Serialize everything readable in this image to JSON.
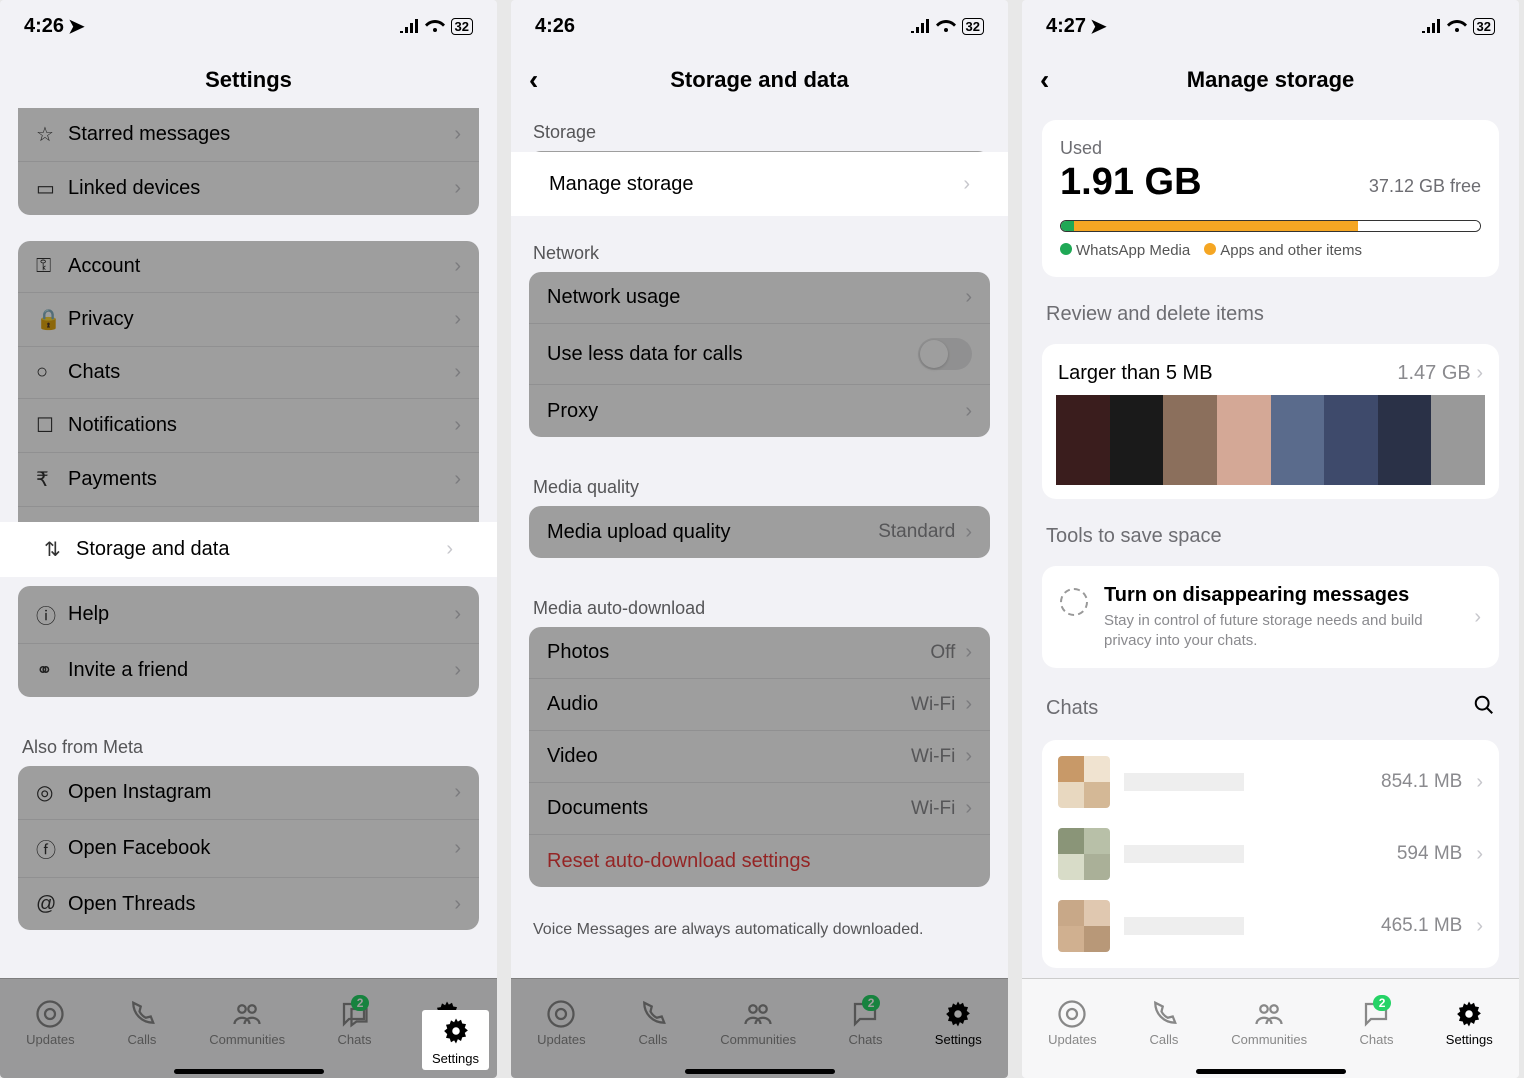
{
  "status": {
    "time1": "4:26",
    "time2": "4:26",
    "time3": "4:27",
    "battery_pct": "32"
  },
  "screen1": {
    "title": "Settings",
    "rows_top": [
      {
        "icon": "☆",
        "label": "Starred messages"
      },
      {
        "icon": "⌐",
        "label": "Linked devices"
      }
    ],
    "rows_main": [
      {
        "icon": "key",
        "label": "Account"
      },
      {
        "icon": "lock",
        "label": "Privacy"
      },
      {
        "icon": "chat",
        "label": "Chats"
      },
      {
        "icon": "bell",
        "label": "Notifications"
      },
      {
        "icon": "pay",
        "label": "Payments"
      },
      {
        "icon": "updown",
        "label": "Storage and data"
      }
    ],
    "rows_help": [
      {
        "icon": "info",
        "label": "Help"
      },
      {
        "icon": "people",
        "label": "Invite a friend"
      }
    ],
    "meta_header": "Also from Meta",
    "rows_meta": [
      {
        "icon": "ig",
        "label": "Open Instagram"
      },
      {
        "icon": "fb",
        "label": "Open Facebook"
      },
      {
        "icon": "th",
        "label": "Open Threads"
      }
    ]
  },
  "screen2": {
    "title": "Storage and data",
    "storage_header": "Storage",
    "manage_storage": "Manage storage",
    "network_header": "Network",
    "network_usage": "Network usage",
    "use_less_data": "Use less data for calls",
    "proxy": "Proxy",
    "media_quality_header": "Media quality",
    "media_upload": "Media upload quality",
    "media_upload_value": "Standard",
    "auto_download_header": "Media auto-download",
    "photos": "Photos",
    "photos_val": "Off",
    "audio": "Audio",
    "audio_val": "Wi-Fi",
    "video": "Video",
    "video_val": "Wi-Fi",
    "documents": "Documents",
    "documents_val": "Wi-Fi",
    "reset": "Reset auto-download settings",
    "voice_note": "Voice Messages are always automatically downloaded."
  },
  "screen3": {
    "title": "Manage storage",
    "used_label": "Used",
    "used_value": "1.91 GB",
    "free_label": "37.12 GB free",
    "legend1": "WhatsApp Media",
    "legend2": "Apps and other items",
    "review_header": "Review and delete items",
    "larger_label": "Larger than 5 MB",
    "larger_value": "1.47 GB",
    "tools_header": "Tools to save space",
    "disappearing_title": "Turn on disappearing messages",
    "disappearing_sub": "Stay in control of future storage needs and build privacy into your chats.",
    "chats_header": "Chats",
    "chats": [
      {
        "size": "854.1 MB"
      },
      {
        "size": "594 MB"
      },
      {
        "size": "465.1 MB"
      }
    ],
    "storage_bar": {
      "whatsapp_pct": 3,
      "apps_pct": 68,
      "free_pct": 29
    }
  },
  "tabs": {
    "updates": "Updates",
    "calls": "Calls",
    "communities": "Communities",
    "chats": "Chats",
    "settings": "Settings",
    "chats_badge": "2"
  }
}
